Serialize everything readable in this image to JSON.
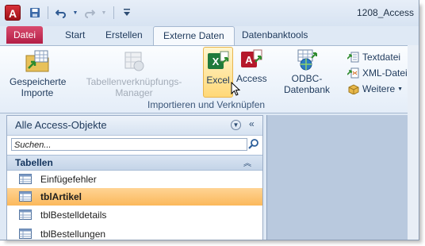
{
  "titlebar": {
    "app_logo_letter": "A",
    "window_title": "1208_Access"
  },
  "qat": {
    "icons": [
      "save-icon",
      "undo-icon",
      "redo-icon",
      "customize-icon"
    ]
  },
  "tabs": [
    {
      "label": "Datei"
    },
    {
      "label": "Start"
    },
    {
      "label": "Erstellen"
    },
    {
      "label": "Externe Daten"
    },
    {
      "label": "Datenbanktools"
    }
  ],
  "ribbon": {
    "saved_imports": {
      "line1": "Gespeicherte",
      "line2": "Importe"
    },
    "linked_table_manager": "Tabellenverknüpfungs-Manager",
    "excel": "Excel",
    "access": "Access",
    "odbc": "ODBC-Datenbank",
    "text_file": "Textdatei",
    "xml_file": "XML-Datei",
    "more": "Weitere",
    "group_label": "Importieren und Verknüpfen"
  },
  "nav": {
    "title": "Alle Access-Objekte",
    "search_placeholder": "Suchen...",
    "group": "Tabellen",
    "items": [
      {
        "label": "Einfügefehler"
      },
      {
        "label": "tblArtikel"
      },
      {
        "label": "tblBestelldetails"
      },
      {
        "label": "tblBestellungen"
      }
    ]
  },
  "colors": {
    "file_tab": "#c02350",
    "selected_item": "#fbc172",
    "excel_hover": "#ffd877"
  }
}
